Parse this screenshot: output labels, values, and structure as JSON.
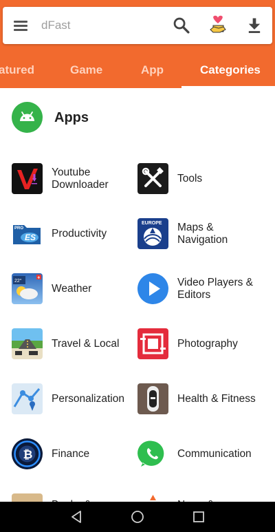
{
  "search": {
    "placeholder": "dFast"
  },
  "icons": {
    "menu": "menu-icon",
    "search": "search-icon",
    "gift": "gift-heart-icon",
    "download": "download-icon"
  },
  "tabs": [
    {
      "label": "atured"
    },
    {
      "label": "Game"
    },
    {
      "label": "App"
    },
    {
      "label": "Categories"
    }
  ],
  "section": {
    "title": "Apps"
  },
  "categories": [
    {
      "label": "Youtube Downloader"
    },
    {
      "label": "Tools"
    },
    {
      "label": "Productivity"
    },
    {
      "label": "Maps & Navigation"
    },
    {
      "label": "Weather"
    },
    {
      "label": "Video Players & Editors"
    },
    {
      "label": "Travel & Local"
    },
    {
      "label": "Photography"
    },
    {
      "label": "Personalization"
    },
    {
      "label": "Health & Fitness"
    },
    {
      "label": "Finance"
    },
    {
      "label": "Communication"
    },
    {
      "label": "Books &"
    },
    {
      "label": "News &"
    }
  ],
  "colors": {
    "brand": "#f26a2e",
    "android_green": "#35b34a"
  }
}
